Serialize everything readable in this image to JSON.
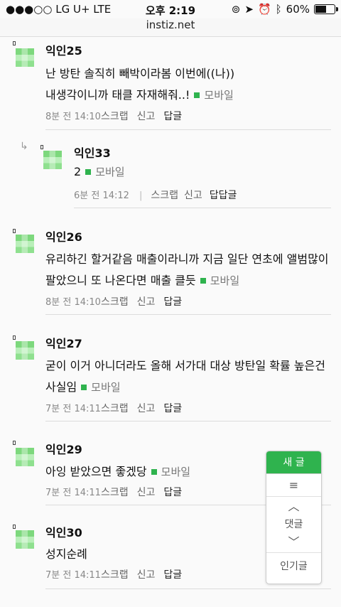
{
  "status": {
    "carrier": "●●●○○ LG U+  LTE",
    "time": "오후 2:19",
    "battery": "60%",
    "battery_level": 0.6
  },
  "url": "instiz.net",
  "comments": [
    {
      "author": "익인25",
      "lines": [
        "난 방탄 솔직히 빼박이라봄 이번에((나))",
        "내생각이니까 태클 자재해줘..!"
      ],
      "mobile": "모바일",
      "time_ago": "8분 전",
      "time": "14:10",
      "scrap": "스크랩",
      "report": "신고",
      "reply": "답글"
    },
    {
      "author": "익인33",
      "lines": [
        "2"
      ],
      "mobile": "모바일",
      "time_ago": "6분 전",
      "time": "14:12",
      "divider": "|",
      "scrap": "스크랩",
      "report": "신고",
      "reply": "답답글",
      "reply_arrow": "↳"
    },
    {
      "author": "익인26",
      "lines": [
        "유리하긴 할거같음 매출이라니까 지금 일단 연초에 앨범많이",
        "팔았으니 또 나온다면 매출 클듯"
      ],
      "mobile": "모바일",
      "time_ago": "8분 전",
      "time": "14:10",
      "scrap": "스크랩",
      "report": "신고",
      "reply": "답글"
    },
    {
      "author": "익인27",
      "lines": [
        "굳이 이거 아니더라도 올해 서가대 대상 방탄일 확률 높은건",
        "사실임"
      ],
      "mobile": "모바일",
      "time_ago": "7분 전",
      "time": "14:11",
      "scrap": "스크랩",
      "report": "신고",
      "reply": "답글"
    },
    {
      "author": "익인29",
      "lines": [
        "아잉 받았으면 좋겠당"
      ],
      "mobile": "모바일",
      "time_ago": "7분 전",
      "time": "14:11",
      "scrap": "스크랩",
      "report": "신고",
      "reply": "답글"
    },
    {
      "author": "익인30",
      "lines": [
        "성지순례"
      ],
      "time_ago": "7분 전",
      "time": "14:11",
      "scrap": "스크랩",
      "report": "신고",
      "reply": "답글"
    }
  ],
  "float_panel": {
    "new_post": "새 글",
    "menu": "≡",
    "up": "︿",
    "comments": "댓글",
    "down": "﹀",
    "popular": "인기글"
  },
  "colors": {
    "accent": "#2fb34e"
  }
}
